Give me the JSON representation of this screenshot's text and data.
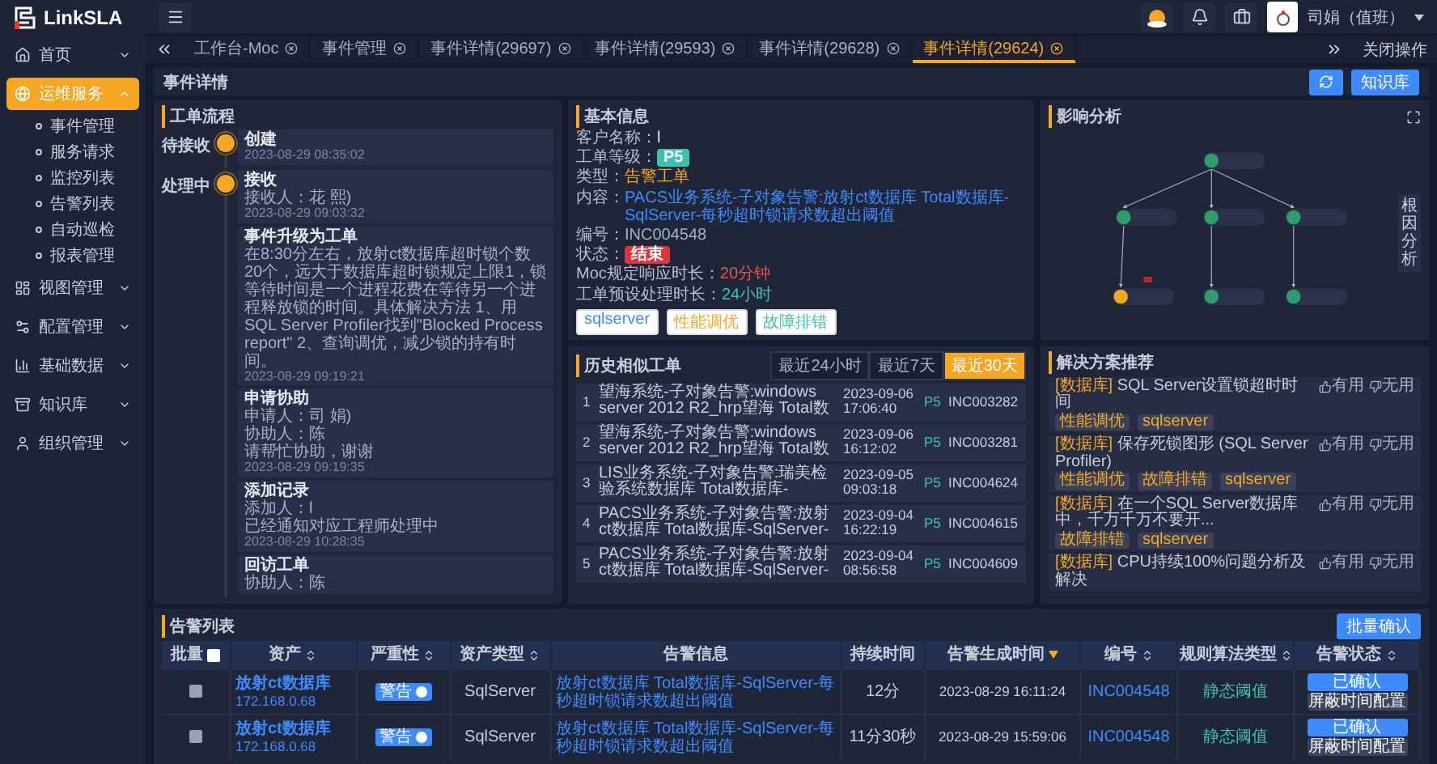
{
  "brand": {
    "name": "LinkSLA"
  },
  "topbar": {
    "user": "司娟（值班）"
  },
  "sidebar": {
    "items": [
      {
        "label": "首页",
        "expanded": false,
        "selected": false
      },
      {
        "label": "运维服务",
        "expanded": true,
        "selected": true,
        "children": [
          {
            "label": "事件管理"
          },
          {
            "label": "服务请求"
          },
          {
            "label": "监控列表"
          },
          {
            "label": "告警列表"
          },
          {
            "label": "自动巡检"
          },
          {
            "label": "报表管理"
          }
        ]
      },
      {
        "label": "视图管理",
        "expanded": false,
        "selected": false
      },
      {
        "label": "配置管理",
        "expanded": false,
        "selected": false
      },
      {
        "label": "基础数据",
        "expanded": false,
        "selected": false
      },
      {
        "label": "知识库",
        "expanded": false,
        "selected": false
      },
      {
        "label": "组织管理",
        "expanded": false,
        "selected": false
      }
    ]
  },
  "tabs": [
    {
      "label": "工作台-Moc",
      "selected": false
    },
    {
      "label": "事件管理",
      "selected": false
    },
    {
      "label": "事件详情(29697)",
      "selected": false
    },
    {
      "label": "事件详情(29593)",
      "selected": false
    },
    {
      "label": "事件详情(29628)",
      "selected": false
    },
    {
      "label": "事件详情(29624)",
      "selected": true
    }
  ],
  "tab_actions": {
    "close_label": "关闭操作"
  },
  "page": {
    "title": "事件详情",
    "knowledge_button": "知识库"
  },
  "workflow": {
    "title": "工单流程",
    "stages": [
      {
        "status": "待接收",
        "entries": [
          {
            "title": "创建",
            "time": "2023-08-29 08:35:02"
          }
        ]
      },
      {
        "status": "处理中",
        "entries": [
          {
            "title": "接收",
            "lines": [
              "接收人：花 熙)"
            ],
            "time": "2023-08-29 09:03:32"
          },
          {
            "title": "事件升级为工单",
            "lines": [
              "在8:30分左右，放射ct数据库超时锁个数20个，远大于数据库超时锁规定上限1，锁等待时间是一个进程花费在等待另一个进程释放锁的时间。具体解决方法 1、用SQL Server Profiler找到\"Blocked Process report\" 2、查询调优，减少锁的持有时间。"
            ],
            "time": "2023-08-29 09:19:21"
          },
          {
            "title": "申请协助",
            "lines": [
              "申请人：司 娟)",
              "协助人：陈",
              "请帮忙协助，谢谢"
            ],
            "time": "2023-08-29 09:19:35"
          },
          {
            "title": "添加记录",
            "lines": [
              "添加人：l",
              "已经通知对应工程师处理中"
            ],
            "time": "2023-08-29 10:28:35"
          },
          {
            "title": "回访工单",
            "lines": [
              "协助人：陈"
            ]
          }
        ]
      }
    ]
  },
  "basic_info": {
    "title": "基本信息",
    "fields": [
      {
        "label": "客户名称：",
        "value": "l",
        "kind": "text"
      },
      {
        "label": "工单等级：",
        "value": "P5",
        "kind": "level"
      },
      {
        "label": "类型：",
        "value": "告警工单",
        "kind": "type"
      },
      {
        "label": "内容：",
        "value": "PACS业务系统-子对象告警:放射ct数据库 Total数据库-SqlServer-每秒超时锁请求数超出阈值",
        "kind": "link"
      },
      {
        "label": "编号：",
        "value": "INC004548",
        "kind": "muted"
      },
      {
        "label": "状态：",
        "value": "结束",
        "kind": "status"
      },
      {
        "label": "Moc规定响应时长：",
        "value": "20分钟",
        "kind": "overdue"
      },
      {
        "label": "工单预设处理时长：",
        "value": "24小时",
        "kind": "duration"
      }
    ],
    "tags": [
      {
        "label": "sqlserver",
        "color": "#3d8bfd"
      },
      {
        "label": "性能调优",
        "color": "#f5a623"
      },
      {
        "label": "故障排错",
        "color": "#3fc1b0"
      }
    ]
  },
  "impact": {
    "title": "影响分析",
    "side_tab": "根因分析"
  },
  "history": {
    "title": "历史相似工单",
    "filters": [
      {
        "label": "最近24小时",
        "selected": false
      },
      {
        "label": "最近7天",
        "selected": false
      },
      {
        "label": "最近30天",
        "selected": true
      }
    ],
    "rows": [
      {
        "index": "1",
        "title": "望海系统-子对象告警:windows server 2012 R2_hrp望海 Total数",
        "time": "2023-09-06 17:06:40",
        "level": "P5",
        "number": "INC003282"
      },
      {
        "index": "2",
        "title": "望海系统-子对象告警:windows server 2012 R2_hrp望海 Total数",
        "time": "2023-09-06 16:12:02",
        "level": "P5",
        "number": "INC003281"
      },
      {
        "index": "3",
        "title": "LIS业务系统-子对象告警:瑞美检验系统数据库 Total数据库-",
        "time": "2023-09-05 09:03:18",
        "level": "P5",
        "number": "INC004624"
      },
      {
        "index": "4",
        "title": "PACS业务系统-子对象告警:放射ct数据库 Total数据库-SqlServer-",
        "time": "2023-09-04 16:22:19",
        "level": "P5",
        "number": "INC004615"
      },
      {
        "index": "5",
        "title": "PACS业务系统-子对象告警:放射ct数据库 Total数据库-SqlServer-",
        "time": "2023-09-04 08:56:58",
        "level": "P5",
        "number": "INC004609"
      }
    ]
  },
  "solutions": {
    "title": "解决方案推荐",
    "items": [
      {
        "category": "[数据库]",
        "title": "SQL Server设置锁超时时间",
        "tags": [
          "性能调优",
          "sqlserver"
        ],
        "useful": "有用",
        "useless": "无用"
      },
      {
        "category": "[数据库]",
        "title": "保存死锁图形 (SQL Server Profiler)",
        "tags": [
          "性能调优",
          "故障排错",
          "sqlserver"
        ],
        "useful": "有用",
        "useless": "无用"
      },
      {
        "category": "[数据库]",
        "title": "在一个SQL Server数据库中，千万千万不要开...",
        "tags": [
          "故障排错",
          "sqlserver"
        ],
        "useful": "有用",
        "useless": "无用"
      },
      {
        "category": "[数据库]",
        "title": "CPU持续100%问题分析及解决",
        "useful": "有用",
        "useless": "无用"
      }
    ]
  },
  "alerts": {
    "title": "告警列表",
    "batch_button": "批量确认",
    "select_all_checked": false,
    "columns": [
      {
        "label": "批量",
        "sortable": false,
        "sorted": false
      },
      {
        "label": "资产",
        "sortable": true,
        "sorted": false
      },
      {
        "label": "严重性",
        "sortable": true,
        "sorted": false
      },
      {
        "label": "资产类型",
        "sortable": true,
        "sorted": false
      },
      {
        "label": "告警信息",
        "sortable": false,
        "sorted": false
      },
      {
        "label": "持续时间",
        "sortable": false,
        "sorted": false
      },
      {
        "label": "告警生成时间",
        "sortable": false,
        "sorted": true
      },
      {
        "label": "编号",
        "sortable": true,
        "sorted": false
      },
      {
        "label": "规则算法类型",
        "sortable": true,
        "sorted": false
      },
      {
        "label": "告警状态",
        "sortable": true,
        "sorted": false
      }
    ],
    "rows": [
      {
        "checked": false,
        "asset": "放射ct数据库",
        "ip": "172.168.0.68",
        "severity": "警告",
        "asset_type": "SqlServer",
        "info": "放射ct数据库 Total数据库-SqlServer-每秒超时锁请求数超出阈值",
        "duration": "12分",
        "time": "2023-08-29 16:11:24",
        "number": "INC004548",
        "rule": "静态阈值",
        "status": "已确认",
        "action": "屏蔽时间配置"
      },
      {
        "checked": false,
        "asset": "放射ct数据库",
        "ip": "172.168.0.68",
        "severity": "警告",
        "asset_type": "SqlServer",
        "info": "放射ct数据库 Total数据库-SqlServer-每秒超时锁请求数超出阈值",
        "duration": "11分30秒",
        "time": "2023-08-29 15:59:06",
        "number": "INC004548",
        "rule": "静态阈值",
        "status": "已确认",
        "action": "屏蔽时间配置"
      }
    ]
  }
}
